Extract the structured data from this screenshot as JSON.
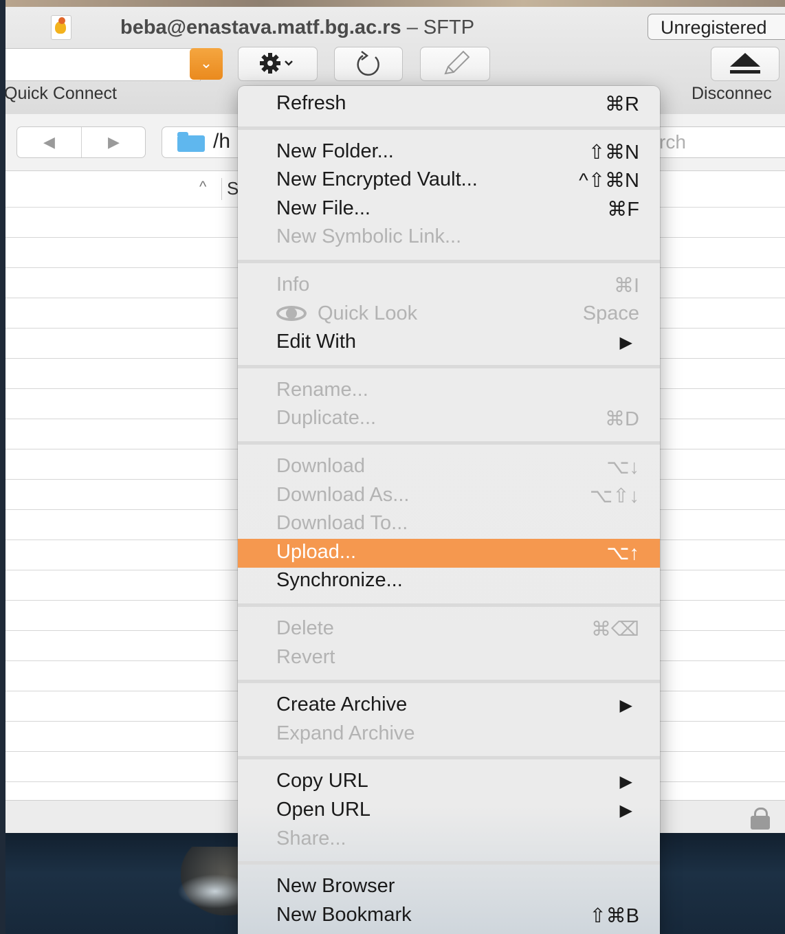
{
  "window": {
    "title_user_host": "beba@enastava.matf.bg.ac.rs",
    "title_protocol": "– SFTP",
    "unregistered": "Unregistered"
  },
  "toolbar": {
    "quick_connect_label": "Quick Connect",
    "disconnect_label": "Disconnec",
    "action_icon": "gear-icon",
    "refresh_icon": "refresh-icon",
    "edit_icon": "pencil-icon",
    "disconnect_icon": "eject-icon"
  },
  "navbar": {
    "back_glyph": "◀",
    "forward_glyph": "▶",
    "path": "/h",
    "search_placeholder": "rch"
  },
  "browser": {
    "sort_indicator": "^",
    "column_label": "S"
  },
  "colors": {
    "highlight": "#f5984f",
    "accent": "#ea8a1e",
    "folder": "#5fb7ee"
  },
  "menu": {
    "groups": [
      [
        {
          "label": "Refresh",
          "shortcut": "⌘R",
          "enabled": true
        }
      ],
      [
        {
          "label": "New Folder...",
          "shortcut": "⇧⌘N",
          "enabled": true
        },
        {
          "label": "New Encrypted Vault...",
          "shortcut": "^⇧⌘N",
          "enabled": true
        },
        {
          "label": "New File...",
          "shortcut": "⌘F",
          "enabled": true
        },
        {
          "label": "New Symbolic Link...",
          "shortcut": "",
          "enabled": false
        }
      ],
      [
        {
          "label": "Info",
          "shortcut": "⌘I",
          "enabled": false
        },
        {
          "label": "Quick Look",
          "shortcut": "Space",
          "enabled": false,
          "icon": "eye-icon"
        },
        {
          "label": "Edit With",
          "shortcut": "",
          "enabled": true,
          "submenu": true
        }
      ],
      [
        {
          "label": "Rename...",
          "shortcut": "",
          "enabled": false
        },
        {
          "label": "Duplicate...",
          "shortcut": "⌘D",
          "enabled": false
        }
      ],
      [
        {
          "label": "Download",
          "shortcut": "⌥↓",
          "enabled": false
        },
        {
          "label": "Download As...",
          "shortcut": "⌥⇧↓",
          "enabled": false
        },
        {
          "label": "Download To...",
          "shortcut": "",
          "enabled": false
        },
        {
          "label": "Upload...",
          "shortcut": "⌥↑",
          "enabled": true,
          "highlighted": true
        },
        {
          "label": "Synchronize...",
          "shortcut": "",
          "enabled": true
        }
      ],
      [
        {
          "label": "Delete",
          "shortcut": "⌘⌫",
          "enabled": false
        },
        {
          "label": "Revert",
          "shortcut": "",
          "enabled": false
        }
      ],
      [
        {
          "label": "Create Archive",
          "shortcut": "",
          "enabled": true,
          "submenu": true
        },
        {
          "label": "Expand Archive",
          "shortcut": "",
          "enabled": false
        }
      ],
      [
        {
          "label": "Copy URL",
          "shortcut": "",
          "enabled": true,
          "submenu": true
        },
        {
          "label": "Open URL",
          "shortcut": "",
          "enabled": true,
          "submenu": true
        },
        {
          "label": "Share...",
          "shortcut": "",
          "enabled": false
        }
      ],
      [
        {
          "label": "New Browser",
          "shortcut": "",
          "enabled": true
        },
        {
          "label": "New Bookmark",
          "shortcut": "⇧⌘B",
          "enabled": true
        }
      ]
    ]
  }
}
